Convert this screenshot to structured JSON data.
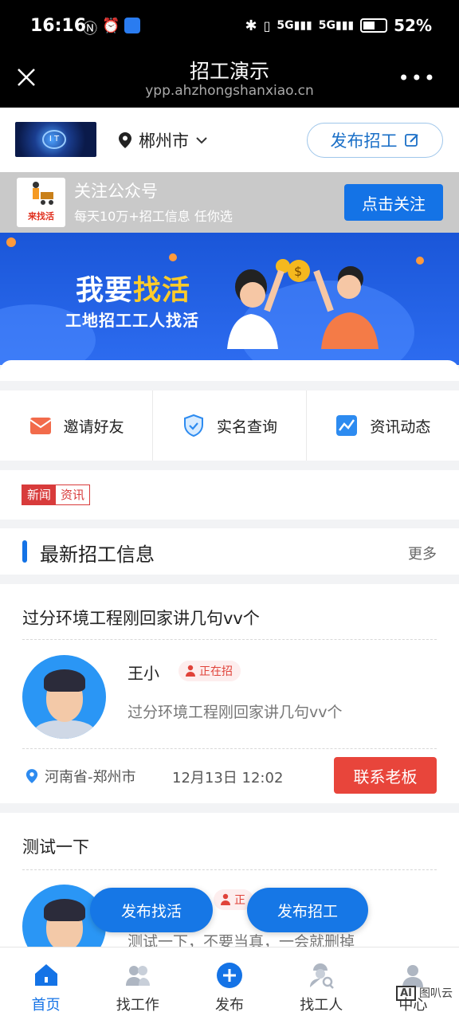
{
  "status_bar": {
    "time": "16:16",
    "battery": "52%",
    "network": "5G"
  },
  "browser": {
    "title": "招工演示",
    "url": "ypp.ahzhongshanxiao.cn"
  },
  "header": {
    "city": "郴州市",
    "post_button": "发布招工"
  },
  "follow_bar": {
    "title": "关注公众号",
    "subtitle": "每天10万+招工信息 任你选",
    "button": "点击关注",
    "logo_text": "来找活"
  },
  "banner": {
    "headline_a": "我要",
    "headline_b": "找活",
    "subline": "工地招工工人找活"
  },
  "quick_links": [
    {
      "label": "邀请好友",
      "icon": "envelope-icon",
      "color": "#f26b4b"
    },
    {
      "label": "实名查询",
      "icon": "shield-check-icon",
      "color": "#2d8bf0"
    },
    {
      "label": "资讯动态",
      "icon": "trend-chart-icon",
      "color": "#2d8bf0"
    }
  ],
  "news_tag": {
    "part1": "新闻",
    "part2": "资讯"
  },
  "section": {
    "title": "最新招工信息",
    "more": "更多"
  },
  "jobs": [
    {
      "title": "过分环境工程刚回家讲几句vv个",
      "name": "王小",
      "status": "正在招",
      "desc": "过分环境工程刚回家讲几句vv个",
      "location": "河南省-郑州市",
      "date": "12月13日 12:02",
      "button": "联系老板"
    },
    {
      "title": "测试一下",
      "status_partial": "正",
      "desc": "测试一下，不要当真，一会就删掉"
    }
  ],
  "floating": {
    "find_work": "发布找活",
    "post_job": "发布招工"
  },
  "tabbar": [
    {
      "label": "首页",
      "icon": "home-icon"
    },
    {
      "label": "找工作",
      "icon": "users-icon"
    },
    {
      "label": "发布",
      "icon": "plus-circle-icon"
    },
    {
      "label": "找工人",
      "icon": "worker-search-icon"
    },
    {
      "label": "中心",
      "icon": "person-icon"
    }
  ],
  "watermark": {
    "badge": "AI",
    "text": "图叭云"
  },
  "colors": {
    "primary": "#1473e6",
    "danger": "#e8453b",
    "accent_yellow": "#ffcc2a"
  }
}
